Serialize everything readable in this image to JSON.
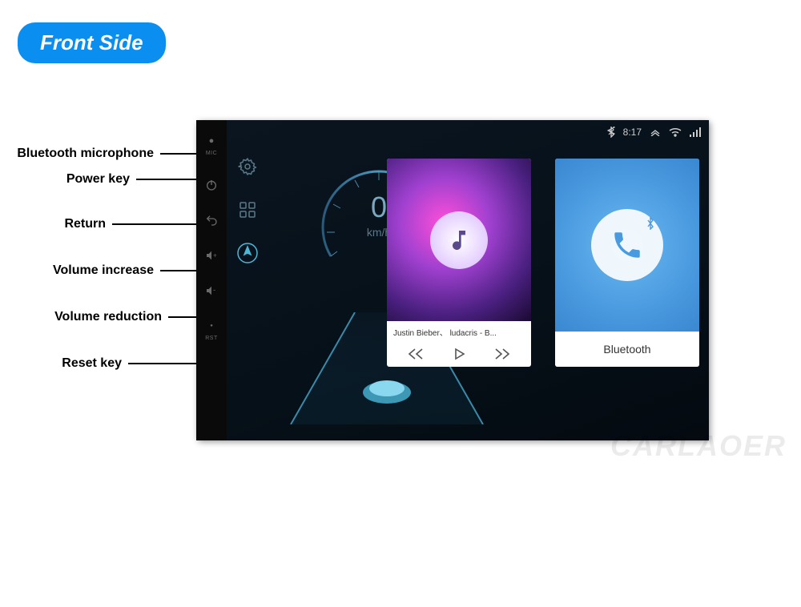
{
  "badge": "Front Side",
  "callouts": [
    "Bluetooth microphone",
    "Power key",
    "Return",
    "Volume increase",
    "Volume reduction",
    "Reset key"
  ],
  "bezel": {
    "mic_label": "MIC",
    "rst_label": "RST"
  },
  "statusbar": {
    "time": "8:17"
  },
  "speed": {
    "value": "0",
    "unit": "km/h"
  },
  "music": {
    "track": "Justin Bieber、 ludacris - B..."
  },
  "bluetooth": {
    "label": "Bluetooth"
  },
  "watermark": "CARLAOER"
}
